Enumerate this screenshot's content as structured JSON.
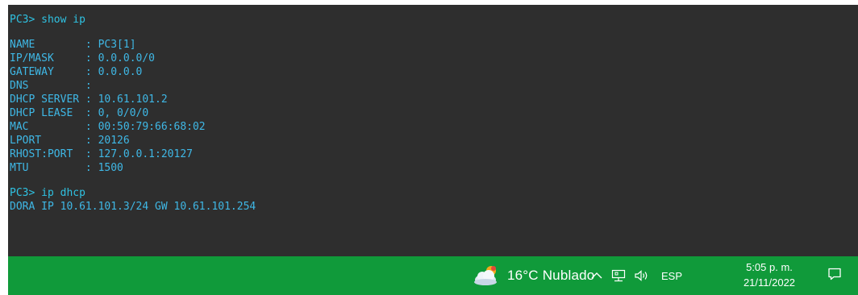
{
  "terminal": {
    "lines": [
      "PC3> show ip",
      "NAME        : PC3[1]",
      "IP/MASK     : 0.0.0.0/0",
      "GATEWAY     : 0.0.0.0",
      "DNS         :",
      "DHCP SERVER : 10.61.101.2",
      "DHCP LEASE  : 0, 0/0/0",
      "MAC         : 00:50:79:66:68:02",
      "LPORT       : 20126",
      "RHOST:PORT  : 127.0.0.1:20127",
      "MTU         : 1500",
      "PC3> ip dhcp",
      "DORA IP 10.61.101.3/24 GW 10.61.101.254"
    ]
  },
  "taskbar": {
    "weather": {
      "icon": "cloudy-weather-icon",
      "text": "16°C  Nublado"
    },
    "tray": {
      "chevron_icon": "chevron-up-icon",
      "network_icon": "network-icon",
      "volume_icon": "volume-icon",
      "language": "ESP"
    },
    "clock": {
      "time": "5:05 p. m.",
      "date": "21/11/2022"
    },
    "notification_icon": "notification-icon"
  },
  "colors": {
    "terminal_bg": "#2e2e2e",
    "terminal_text": "#3fb8e6",
    "taskbar_bg": "#109a3a"
  }
}
